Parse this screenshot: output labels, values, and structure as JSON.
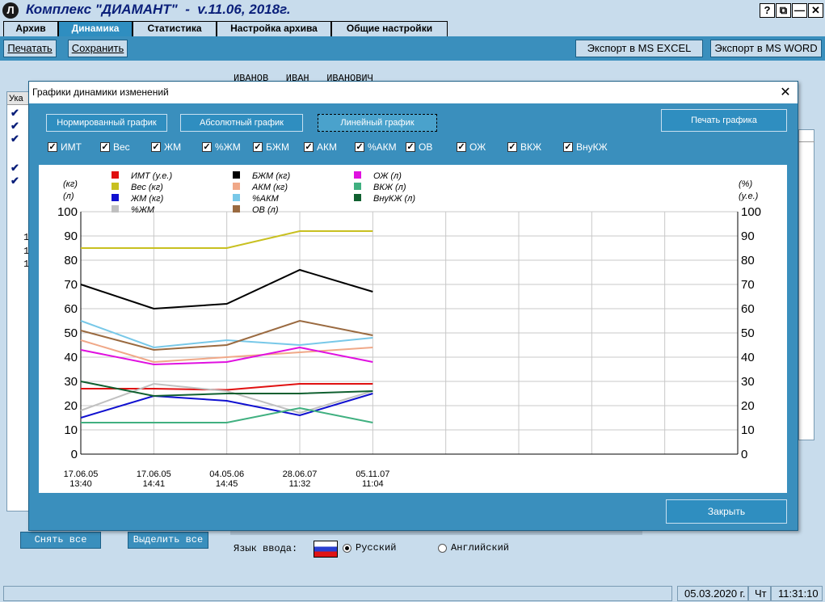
{
  "app": {
    "title": "Комплекс \"ДИАМАНТ\"  -  v.11.06, 2018г.",
    "logo": "Л",
    "window_buttons": [
      "?",
      "⧉",
      "—",
      "✕"
    ]
  },
  "tabs": [
    {
      "label": "Архив",
      "active": false
    },
    {
      "label": "Динамика",
      "active": true
    },
    {
      "label": "Статистика",
      "active": false
    },
    {
      "label": "Настройка архива",
      "active": false
    },
    {
      "label": "Общие настройки",
      "active": false
    }
  ],
  "toolbar": {
    "print": "Печатать",
    "save": "Сохранить",
    "export_excel": "Экспорт в MS EXCEL",
    "export_word": "Экспорт в MS WORD"
  },
  "background": {
    "patient_name": "ИВАНОВ   ИВАН   ИВАНОВИЧ",
    "panel_header": "Ука",
    "digits": [
      "1",
      "1",
      "1"
    ],
    "deselect_all": "Снять все",
    "select_all": "Выделить все",
    "input_lang_label": "Язык ввода:",
    "lang_russian": "Русский",
    "lang_english": "Английский"
  },
  "status": {
    "date": "05.03.2020 г.",
    "weekday": "Чт",
    "time": "11:31:10"
  },
  "dialog": {
    "title": "Графики динамики изменений",
    "close_icon": "✕",
    "modes": [
      {
        "label": "Нормированный график",
        "active": false
      },
      {
        "label": "Абсолютный график",
        "active": false
      },
      {
        "label": "Линейный график",
        "active": true
      }
    ],
    "print_chart": "Печать графика",
    "close": "Закрыть",
    "checkboxes": [
      {
        "label": "ИМТ",
        "checked": true
      },
      {
        "label": "Вес",
        "checked": true
      },
      {
        "label": "ЖМ",
        "checked": true
      },
      {
        "label": "%ЖМ",
        "checked": true
      },
      {
        "label": "БЖМ",
        "checked": true
      },
      {
        "label": "АКМ",
        "checked": true
      },
      {
        "label": "%АКМ",
        "checked": true
      },
      {
        "label": "ОВ",
        "checked": true
      },
      {
        "label": "ОЖ",
        "checked": true
      },
      {
        "label": "ВКЖ",
        "checked": true
      },
      {
        "label": "ВнуКЖ",
        "checked": true
      }
    ]
  },
  "chart_data": {
    "type": "line",
    "left_unit": [
      "(кг)",
      "(л)"
    ],
    "right_unit": [
      "(%)",
      "(у.е.)"
    ],
    "ylim": [
      0,
      100
    ],
    "yticks": [
      0,
      10,
      20,
      30,
      40,
      50,
      60,
      70,
      80,
      90,
      100
    ],
    "grid": true,
    "legend_position": "top",
    "x_slots": 9,
    "categories": [
      [
        "17.06.05",
        "13:40"
      ],
      [
        "17.06.05",
        "14:41"
      ],
      [
        "04.05.06",
        "14:45"
      ],
      [
        "28.06.07",
        "11:32"
      ],
      [
        "05.11.07",
        "11:04"
      ]
    ],
    "series": [
      {
        "name": "ИМТ (у.е.)",
        "color": "#e01010",
        "values": [
          27,
          27,
          26.5,
          29,
          29
        ]
      },
      {
        "name": "Вес (кг)",
        "color": "#c8c020",
        "values": [
          85,
          85,
          85,
          92,
          92
        ]
      },
      {
        "name": "ЖМ (кг)",
        "color": "#1010d0",
        "values": [
          15,
          24,
          22,
          16,
          25
        ]
      },
      {
        "name": "%ЖМ",
        "color": "#c0c0c0",
        "values": [
          18,
          29,
          26,
          17,
          26
        ]
      },
      {
        "name": "БЖМ (кг)",
        "color": "#000000",
        "values": [
          70,
          60,
          62,
          76,
          67
        ]
      },
      {
        "name": "АКМ (кг)",
        "color": "#f0a888",
        "values": [
          47,
          38,
          40,
          42,
          44
        ]
      },
      {
        "name": "%АКМ",
        "color": "#78c8e8",
        "values": [
          55,
          44,
          47,
          45,
          48
        ]
      },
      {
        "name": "ОВ (л)",
        "color": "#9a6a40",
        "values": [
          51,
          43,
          45,
          55,
          49
        ]
      },
      {
        "name": "ОЖ (л)",
        "color": "#e010e0",
        "values": [
          43,
          37,
          38,
          44,
          38
        ]
      },
      {
        "name": "ВКЖ (л)",
        "color": "#40b080",
        "values": [
          13,
          13,
          13,
          19,
          13
        ]
      },
      {
        "name": "ВнуКЖ (л)",
        "color": "#106030",
        "values": [
          30,
          24,
          25,
          25,
          26
        ]
      }
    ]
  }
}
